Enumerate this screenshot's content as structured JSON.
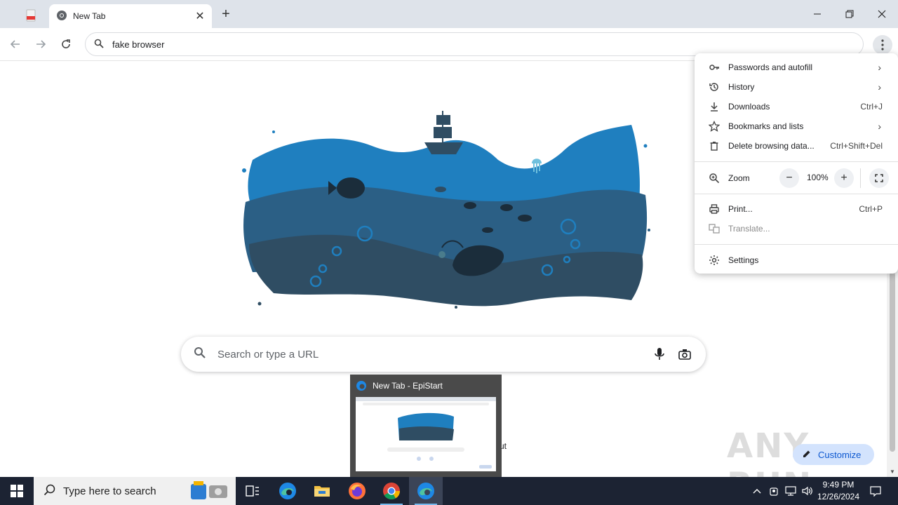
{
  "tabs": {
    "active_title": "New Tab"
  },
  "toolbar": {
    "address_text": "fake browser"
  },
  "ntp": {
    "search_placeholder": "Search or type a URL",
    "customize_label": "Customize",
    "cut_text": "cut",
    "watermark": "ANY RUN"
  },
  "menu": {
    "items": [
      {
        "label": "Passwords and autofill",
        "icon": "key-icon",
        "submenu": true
      },
      {
        "label": "History",
        "icon": "history-icon",
        "submenu": true
      },
      {
        "label": "Downloads",
        "icon": "download-icon",
        "shortcut": "Ctrl+J"
      },
      {
        "label": "Bookmarks and lists",
        "icon": "star-icon",
        "submenu": true
      },
      {
        "label": "Delete browsing data...",
        "icon": "trash-icon",
        "shortcut": "Ctrl+Shift+Del"
      },
      {
        "label": "Print...",
        "icon": "printer-icon",
        "shortcut": "Ctrl+P"
      },
      {
        "label": "Translate...",
        "icon": "translate-icon",
        "disabled": true
      },
      {
        "label": "Settings",
        "icon": "gear-icon"
      }
    ],
    "zoom": {
      "label": "Zoom",
      "value": "100%"
    }
  },
  "taskbar": {
    "search_placeholder": "Type here to search",
    "preview_title": "New Tab - EpiStart",
    "time": "9:49 PM",
    "date": "12/26/2024"
  },
  "colors": {
    "ocean_light": "#1f7fbf",
    "ocean_mid": "#2b5f85",
    "ocean_dark": "#2f4d63",
    "taskbar": "#1c2333",
    "accent": "#0b57d0"
  }
}
